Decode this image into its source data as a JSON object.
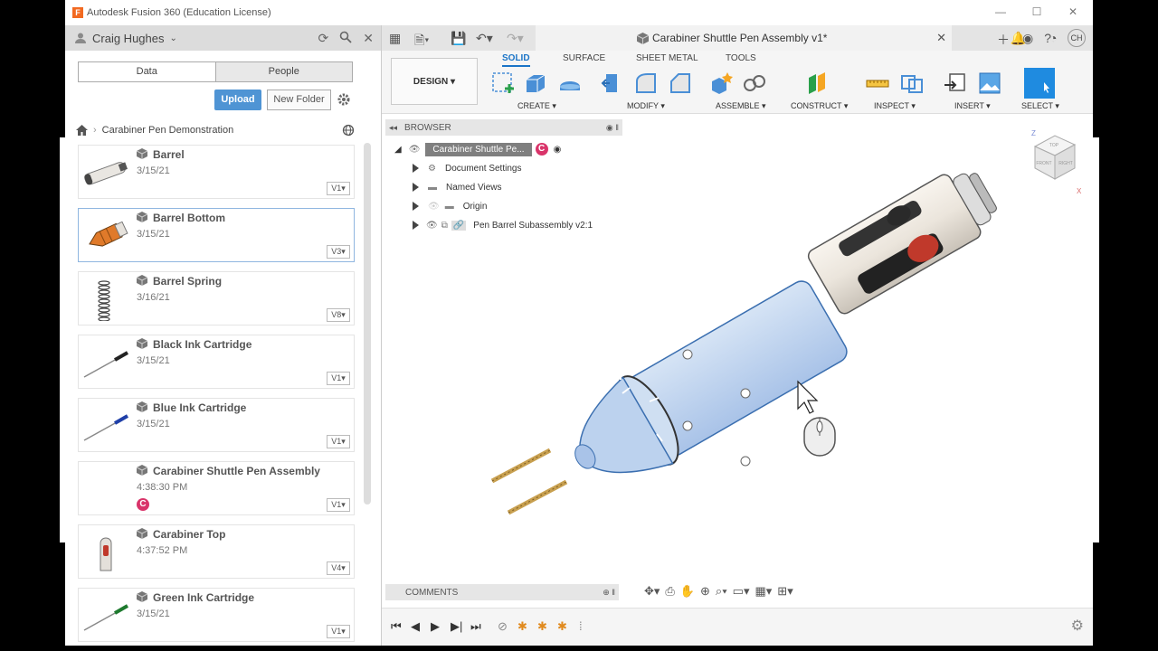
{
  "window": {
    "title": "Autodesk Fusion 360 (Education License)",
    "logo_letter": "F",
    "controls": [
      "—",
      "☐",
      "✕"
    ]
  },
  "data_panel": {
    "user": "Craig Hughes",
    "tabs": [
      "Data",
      "People"
    ],
    "upload_label": "Upload",
    "new_folder_label": "New Folder",
    "breadcrumb": "Carabiner Pen Demonstration",
    "files": [
      {
        "name": "Barrel",
        "date": "3/15/21",
        "version": "V1▾"
      },
      {
        "name": "Barrel Bottom",
        "date": "3/15/21",
        "version": "V3▾"
      },
      {
        "name": "Barrel Spring",
        "date": "3/16/21",
        "version": "V8▾"
      },
      {
        "name": "Black Ink Cartridge",
        "date": "3/15/21",
        "version": "V1▾"
      },
      {
        "name": "Blue Ink Cartridge",
        "date": "3/15/21",
        "version": "V1▾"
      },
      {
        "name": "Carabiner Shuttle Pen Assembly",
        "date": "4:38:30 PM",
        "version": "V1▾",
        "badge": "C"
      },
      {
        "name": "Carabiner Top",
        "date": "4:37:52 PM",
        "version": "V4▾"
      },
      {
        "name": "Green Ink Cartridge",
        "date": "3/15/21",
        "version": "V1▾"
      }
    ]
  },
  "document": {
    "title": "Carabiner Shuttle Pen Assembly v1*",
    "user_initials": "CH"
  },
  "ribbon": {
    "workspace": "DESIGN ▾",
    "tabs": [
      "SOLID",
      "SURFACE",
      "SHEET METAL",
      "TOOLS"
    ],
    "groups": [
      "CREATE ▾",
      "MODIFY ▾",
      "ASSEMBLE ▾",
      "CONSTRUCT ▾",
      "INSPECT ▾",
      "INSERT ▾",
      "SELECT ▾"
    ]
  },
  "browser": {
    "header": "BROWSER",
    "root": "Carabiner Shuttle Pe...",
    "root_badge": "C",
    "items": [
      "Document Settings",
      "Named Views",
      "Origin",
      "Pen Barrel Subassembly v2:1"
    ]
  },
  "comments_label": "COMMENTS",
  "viewcube": {
    "top": "TOP",
    "front": "FRONT",
    "right": "RIGHT",
    "axis_z": "Z",
    "axis_x": "X"
  }
}
